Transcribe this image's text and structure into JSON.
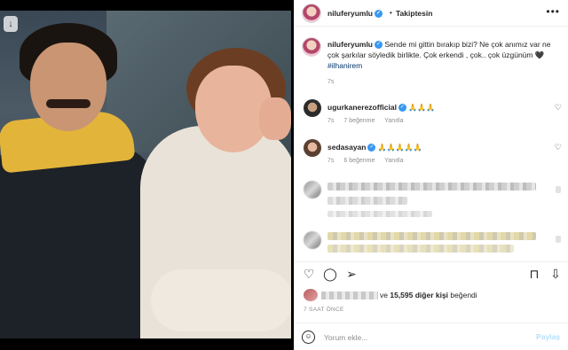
{
  "header": {
    "username": "niluferyumlu",
    "verified_icon": "verified-badge-icon",
    "separator": "•",
    "follow_status": "Takiptesin",
    "more_icon": "more-options-icon"
  },
  "caption": {
    "username": "niluferyumlu",
    "text": "Sende mi gittin bırakıp bizi? Ne çok anımız var ne çok şarkılar söyledik birlikte. Çok erkendi , çok.. çok üzgünüm 🖤",
    "hashtag": "#ilhanirem",
    "time": "7s"
  },
  "comments": [
    {
      "username": "ugurkanerezofficial",
      "text": "🙏🙏🙏",
      "time": "7s",
      "likes": "7 beğenme",
      "reply": "Yanıtla"
    },
    {
      "username": "sedasayan",
      "text": "🙏🙏🙏🙏🙏",
      "time": "7s",
      "likes": "6 beğenme",
      "reply": "Yanıtla"
    }
  ],
  "actions": {
    "like_icon": "heart-icon",
    "comment_icon": "comment-icon",
    "share_icon": "share-icon",
    "save_icon": "bookmark-icon",
    "download_icon": "download-icon"
  },
  "likes": {
    "prefix": "ve",
    "count_text": "15,595 diğer kişi",
    "suffix": "beğendi"
  },
  "post_time": "7 SAAT ÖNCE",
  "composer": {
    "placeholder": "Yorum ekle...",
    "post_label": "Paylaş"
  },
  "photo": {
    "download_overlay_icon": "download-arrow-icon"
  },
  "colors": {
    "link": "#00376b",
    "verified": "#3897f0",
    "muted": "#8e8e8e",
    "post_button_disabled": "#b2dffc"
  }
}
